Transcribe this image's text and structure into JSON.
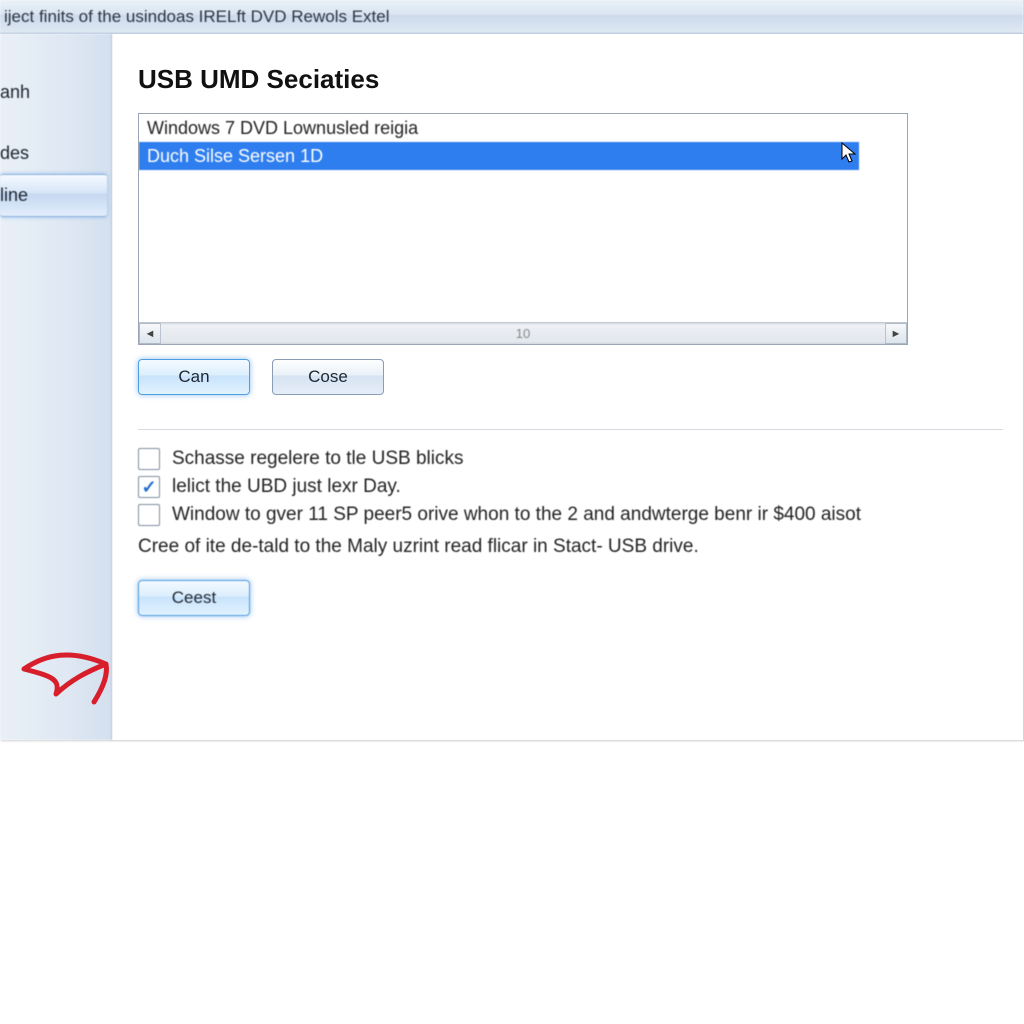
{
  "titlebar": "iject finits of the usindoas IRELft DVD Rewols Extel",
  "sidebar": {
    "items": [
      {
        "label": "anh"
      },
      {
        "label": ""
      },
      {
        "label": "des"
      },
      {
        "label": "line"
      }
    ],
    "selected_index": 3
  },
  "main": {
    "heading": "USB UMD Seciaties",
    "list": {
      "items": [
        "Windows 7 DVD Lownusled reigia",
        "Duch Silse Sersen 1D"
      ],
      "selected_index": 1,
      "scroll_center_text": "10"
    },
    "buttons": {
      "can": "Can",
      "cose": "Cose",
      "ceest": "Ceest"
    },
    "checkboxes": [
      {
        "label": "Schasse regelere to tle USB blicks",
        "checked": false
      },
      {
        "label": "lelict the UBD just lexr Day.",
        "checked": true
      },
      {
        "label": "Window to gver 11 SP peer5 orive whon to the 2 and andwterge benr ir $400 aisot",
        "checked": false
      }
    ],
    "note": "Cree of ite de-tald to the Maly uzrint read flicar in Stact- USB drive."
  }
}
